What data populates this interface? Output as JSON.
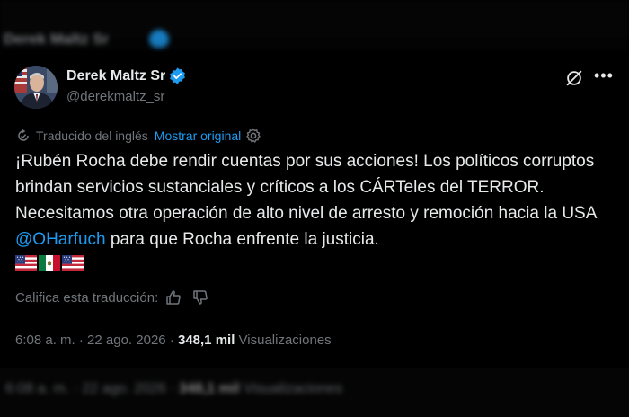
{
  "author": {
    "name": "Derek Maltz Sr",
    "handle": "@derekmaltz_sr"
  },
  "translation": {
    "label": "Traducido del inglés",
    "show_original": "Mostrar original"
  },
  "tweet": {
    "text_part1": "¡Rubén Rocha debe rendir cuentas por sus acciones! Los políticos corruptos brindan servicios sustanciales y críticos a los CÁRTeles del TERROR. Necesitamos otra operación de alto nivel de arresto y remoción hacia la USA ",
    "mention": "@OHarfuch",
    "text_part2": " para que Rocha enfrente la justicia.",
    "flags": [
      "us-flag",
      "mexico-flag",
      "us-flag"
    ]
  },
  "rating": {
    "label": "Califica esta traducción:"
  },
  "meta": {
    "time": "6:08 a. m.",
    "separator": "·",
    "date": "22 ago. 2026",
    "views_count": "348,1 mil",
    "views_label": "Visualizaciones"
  },
  "colors": {
    "accent": "#1d9bf0",
    "text": "#e7e9ea",
    "secondary": "#71767b",
    "background": "#000000"
  }
}
